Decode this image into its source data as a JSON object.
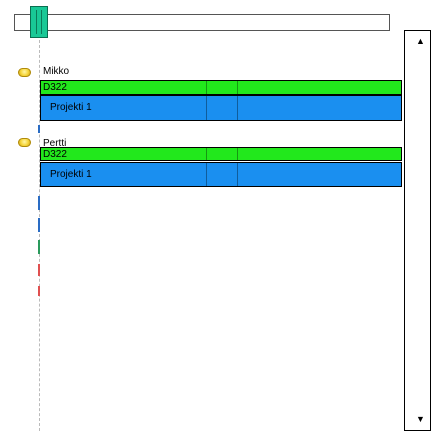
{
  "timeline": {
    "slider_label": "",
    "slider_position": 0.07
  },
  "people": [
    {
      "name": "Mikko",
      "assignments": [
        {
          "label": "D322",
          "color": "#22e81c"
        },
        {
          "label": "Projekti 1",
          "color": "#1a8ff0"
        }
      ]
    },
    {
      "name": "Pertti",
      "assignments": [
        {
          "label": "D322",
          "color": "#22e81c"
        },
        {
          "label": "Projekti 1",
          "color": "#1a8ff0"
        }
      ]
    }
  ],
  "scrollbar": {
    "up_arrow": "▲",
    "down_arrow": "▼"
  }
}
